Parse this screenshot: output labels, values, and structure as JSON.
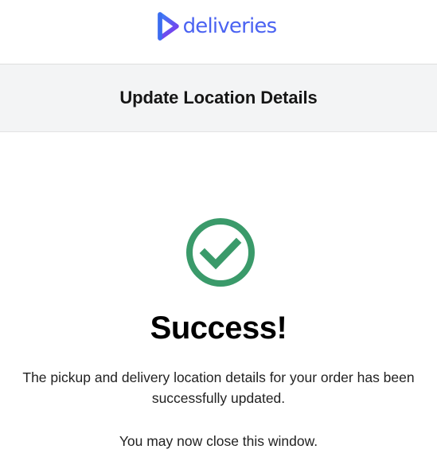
{
  "brand": {
    "name": "deliveries",
    "color": "#4b63f2",
    "mark_gradient": [
      "#3b82f6",
      "#7c3aed"
    ]
  },
  "header": {
    "title": "Update Location Details"
  },
  "status": {
    "icon": "check-circle-icon",
    "color": "#3a9a6a",
    "title": "Success!",
    "message": "The pickup and delivery location details for your order has been successfully updated.",
    "close_note": "You may now close this window."
  }
}
